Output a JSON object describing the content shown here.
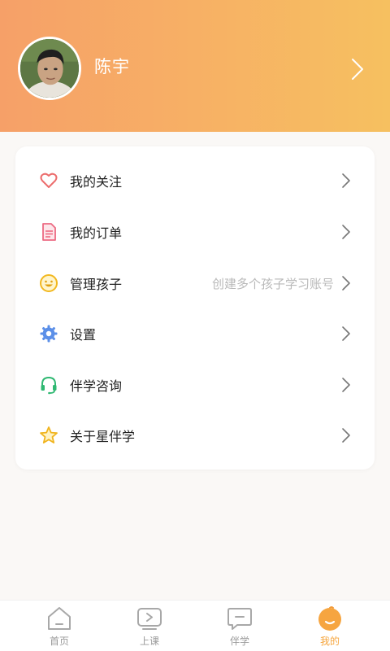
{
  "profile": {
    "name": "陈宇"
  },
  "menu": {
    "items": [
      {
        "label": "我的关注",
        "icon": "heart-icon",
        "hint": ""
      },
      {
        "label": "我的订单",
        "icon": "order-document-icon",
        "hint": ""
      },
      {
        "label": "管理孩子",
        "icon": "smiley-face-icon",
        "hint": "创建多个孩子学习账号"
      },
      {
        "label": "设置",
        "icon": "gear-icon",
        "hint": ""
      },
      {
        "label": "伴学咨询",
        "icon": "headset-icon",
        "hint": ""
      },
      {
        "label": "关于星伴学",
        "icon": "star-icon",
        "hint": ""
      }
    ]
  },
  "bottom_nav": {
    "items": [
      {
        "label": "首页",
        "icon": "home-icon",
        "active": false
      },
      {
        "label": "上课",
        "icon": "play-class-icon",
        "active": false
      },
      {
        "label": "伴学",
        "icon": "chat-bubble-icon",
        "active": false
      },
      {
        "label": "我的",
        "icon": "profile-face-icon",
        "active": true
      }
    ]
  },
  "colors": {
    "header_gradient_start": "#f6a068",
    "header_gradient_end": "#f6c060",
    "accent": "#f6a53c",
    "inactive": "#9a9a9a"
  }
}
